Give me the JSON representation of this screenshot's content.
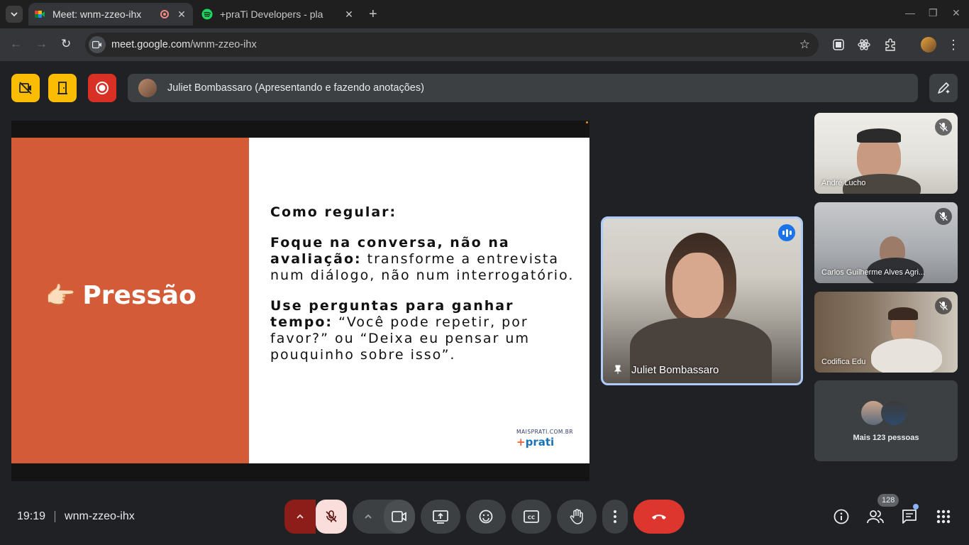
{
  "browser": {
    "tabs": [
      {
        "title": "Meet: wnm-zzeo-ihx",
        "active": true
      },
      {
        "title": "+praTi Developers - pla",
        "active": false
      }
    ],
    "url_host": "meet.google.com",
    "url_path": "/wnm-zzeo-ihx"
  },
  "meet": {
    "presenter_banner": "Juliet Bombassaro (Apresentando e fazendo anotações)",
    "slide": {
      "heading": "Pressão",
      "heading_emoji": "👉🏻",
      "intro": "Como regular:",
      "point1_bold": "Foque na conversa, não na avaliação:",
      "point1_text": " transforme a entrevista num diálogo, não num interrogatório.",
      "point2_bold": "Use perguntas para ganhar tempo:",
      "point2_text": " “Você pode repetir, por favor?” ou “Deixa eu pensar um pouquinho sobre isso”.",
      "logo_site": "MAISPRATI.COM.BR",
      "logo_plus": "+",
      "logo_name": "prati"
    },
    "main_speaker": "Juliet Bombassaro",
    "participants": [
      {
        "name": "André Lucho"
      },
      {
        "name": "Carlos Guilherme Alves Agri..."
      },
      {
        "name": "Codifica Edu"
      }
    ],
    "more_people": "Mais 123 pessoas",
    "clock": "19:19",
    "meeting_code": "wnm-zzeo-ihx",
    "participant_count": "128"
  },
  "colors": {
    "slide_accent": "#d45b38",
    "end_call": "#dc362e",
    "warning_yellow": "#fbbc04",
    "record_red": "#d93025",
    "speaking_blue": "#1a73e8"
  },
  "icons": [
    "tab-list-icon",
    "meet-favicon",
    "spotify-favicon",
    "recording-icon",
    "close-icon",
    "new-tab-icon",
    "minimize-icon",
    "maximize-icon",
    "back-icon",
    "forward-icon",
    "reload-icon",
    "site-info-icon",
    "bookmark-star-icon",
    "extension-icon",
    "profile-avatar-icon",
    "menu-icon",
    "no-video-icon",
    "door-icon",
    "record-icon",
    "annotate-pen-icon",
    "pin-icon",
    "mic-off-icon",
    "camera-icon",
    "present-icon",
    "emoji-icon",
    "captions-icon",
    "raise-hand-icon",
    "more-options-icon",
    "end-call-icon",
    "info-icon",
    "people-icon",
    "chat-icon",
    "activities-icon"
  ]
}
